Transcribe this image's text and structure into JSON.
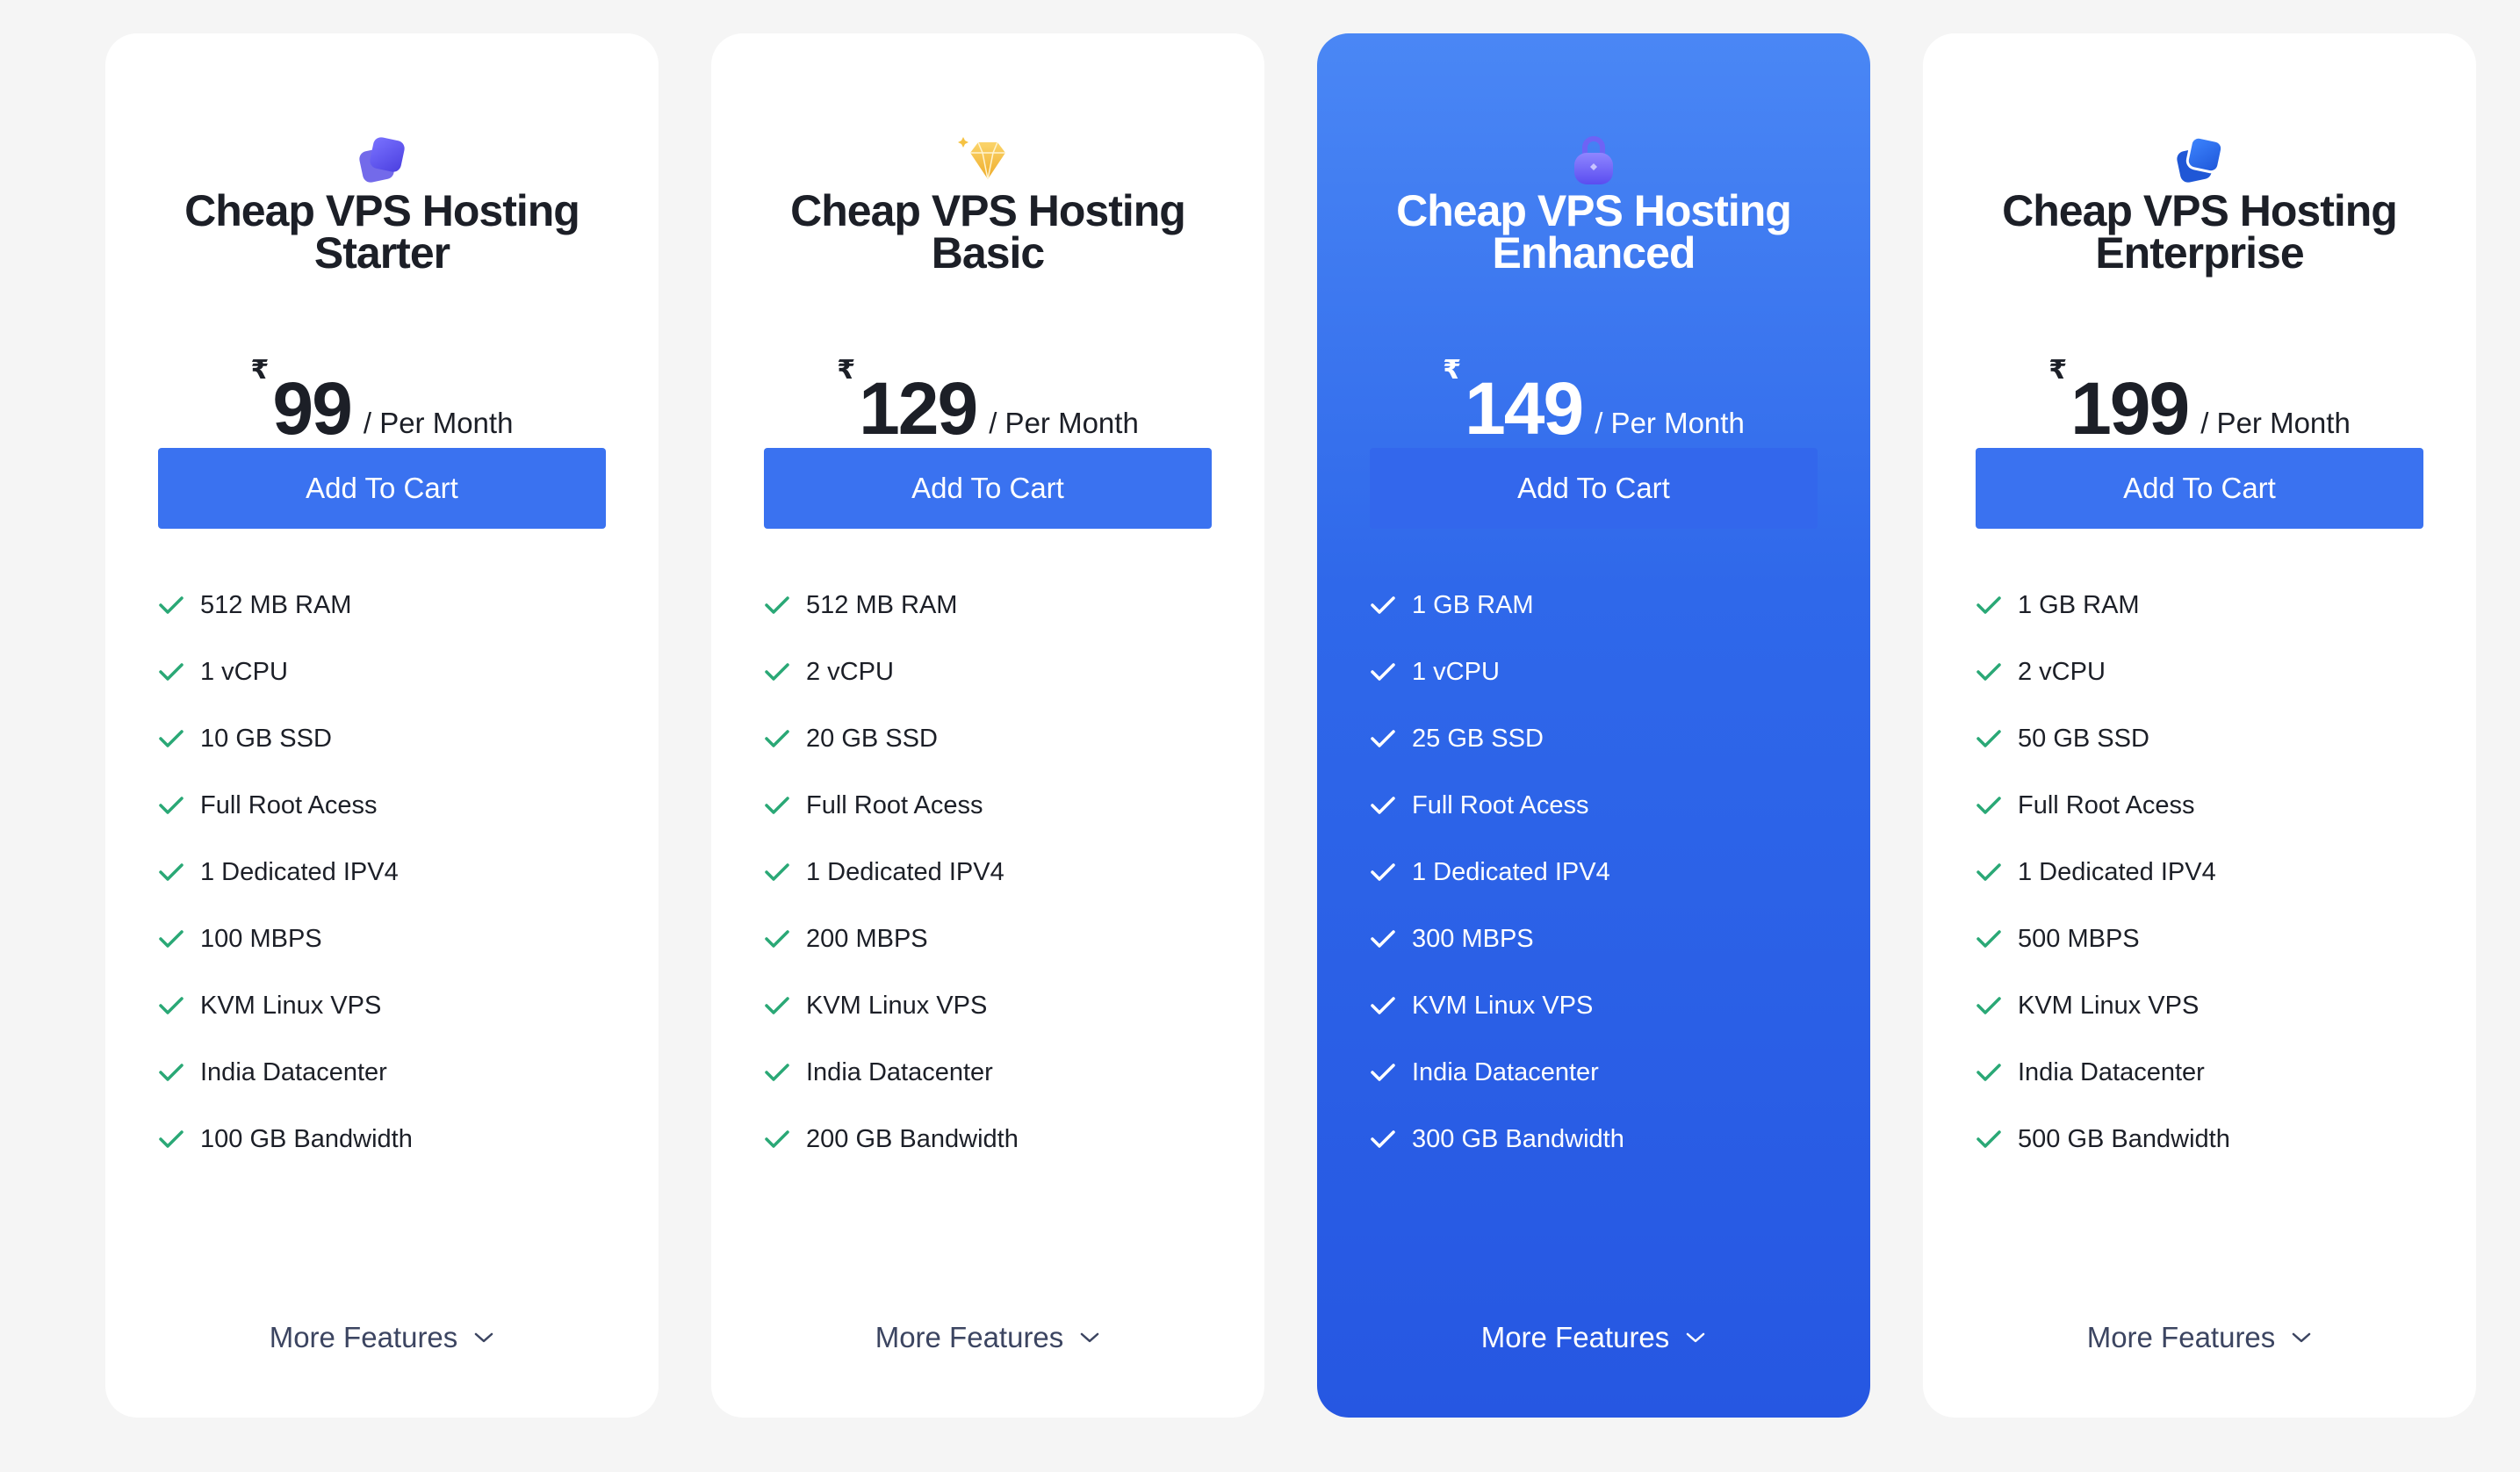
{
  "colors": {
    "accent": "#3a72f0",
    "check": "#2aa876",
    "featured_background": "#2f68ea",
    "page_background": "#f5f5f5"
  },
  "plans": [
    {
      "icon": "stacked-squares-icon",
      "title_line1": "Cheap VPS Hosting",
      "title_line2": "Starter",
      "currency": "₹",
      "price": "99",
      "period": "/ Per Month",
      "cart_label": "Add To Cart",
      "features": [
        "512 MB RAM",
        "1 vCPU",
        "10 GB SSD",
        "Full Root Acess",
        "1 Dedicated IPV4",
        "100 MBPS",
        "KVM Linux VPS",
        "India Datacenter",
        "100 GB Bandwidth"
      ],
      "more_label": "More Features"
    },
    {
      "icon": "diamond-icon",
      "title_line1": "Cheap VPS Hosting",
      "title_line2": "Basic",
      "currency": "₹",
      "price": "129",
      "period": "/ Per Month",
      "cart_label": "Add To Cart",
      "features": [
        "512 MB RAM",
        "2 vCPU",
        "20 GB SSD",
        "Full Root Acess",
        "1 Dedicated IPV4",
        "200 MBPS",
        "KVM Linux VPS",
        "India Datacenter",
        "200 GB Bandwidth"
      ],
      "more_label": "More Features"
    },
    {
      "icon": "lock-icon",
      "title_line1": "Cheap VPS Hosting",
      "title_line2": "Enhanced",
      "currency": "₹",
      "price": "149",
      "period": "/ Per Month",
      "cart_label": "Add To Cart",
      "features": [
        "1 GB RAM",
        "1 vCPU",
        "25 GB SSD",
        "Full Root Acess",
        "1 Dedicated IPV4",
        "300 MBPS",
        "KVM Linux VPS",
        "India Datacenter",
        "300 GB Bandwidth"
      ],
      "more_label": "More Features"
    },
    {
      "icon": "stacked-squares-icon",
      "title_line1": "Cheap VPS Hosting",
      "title_line2": "Enterprise",
      "currency": "₹",
      "price": "199",
      "period": "/ Per Month",
      "cart_label": "Add To Cart",
      "features": [
        "1 GB RAM",
        "2 vCPU",
        "50 GB SSD",
        "Full Root Acess",
        "1 Dedicated IPV4",
        "500 MBPS",
        "KVM Linux VPS",
        "India Datacenter",
        "500 GB Bandwidth"
      ],
      "more_label": "More Features"
    }
  ]
}
